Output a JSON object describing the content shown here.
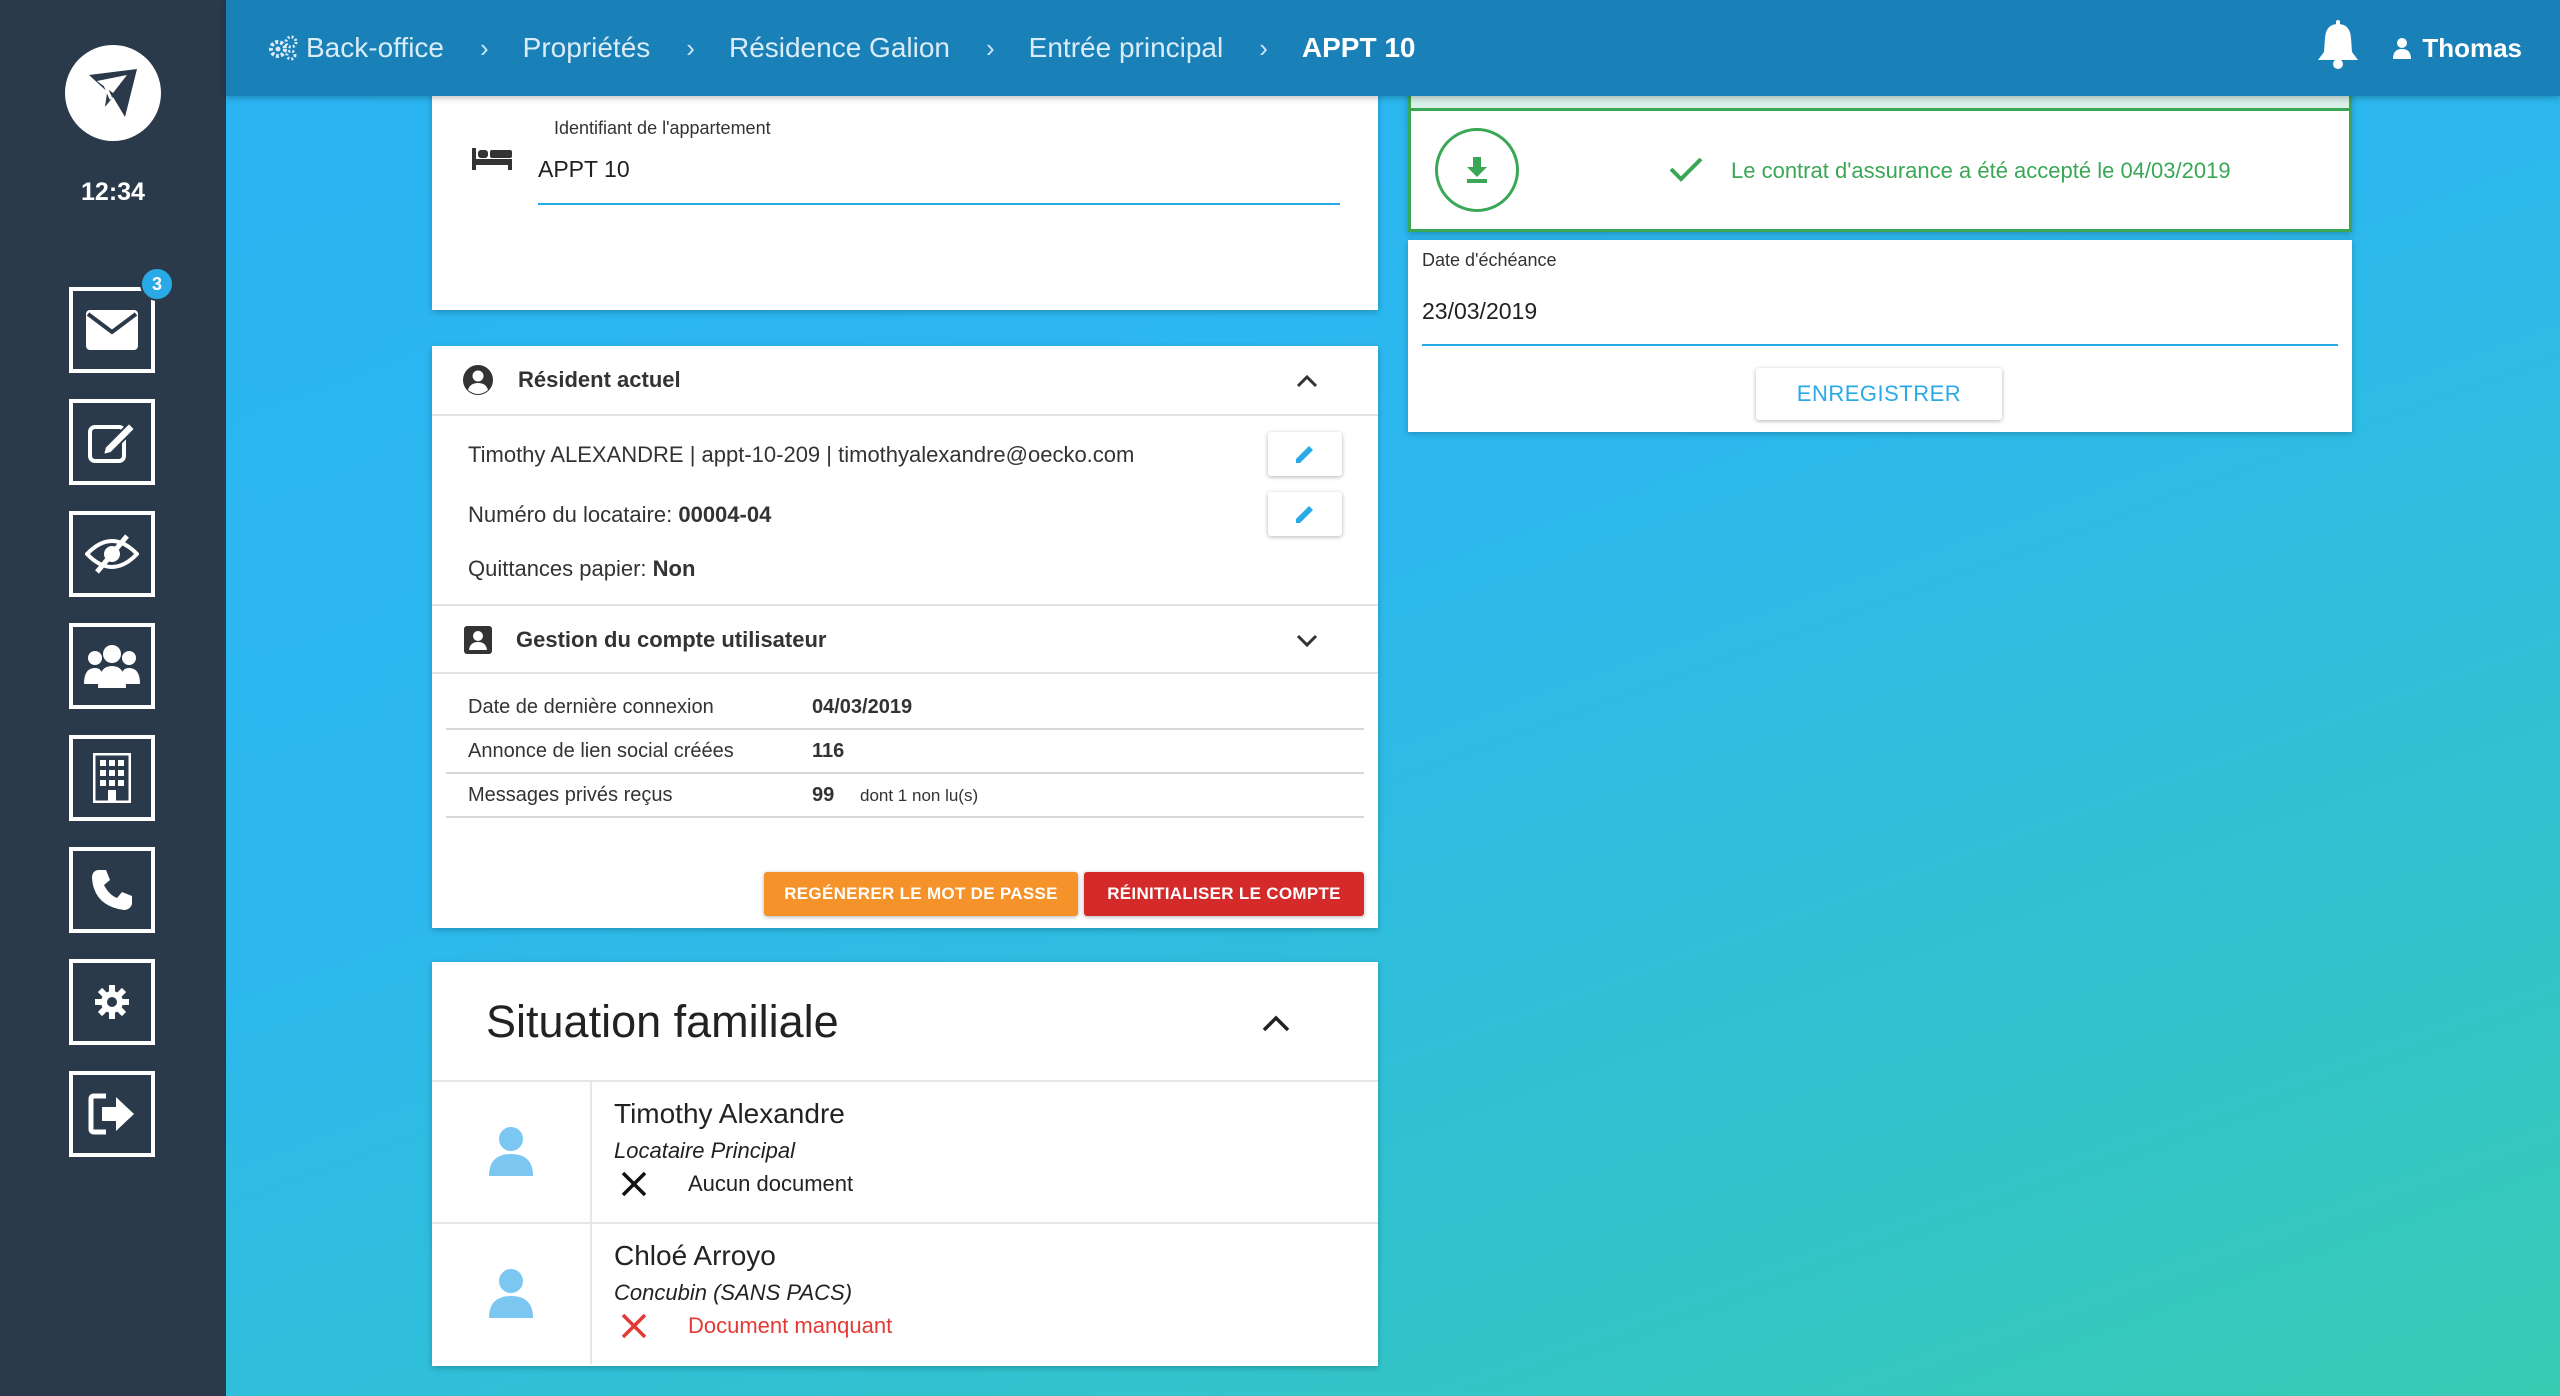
{
  "sidebar": {
    "time": "12:34",
    "mail_badge": "3",
    "items": [
      {
        "name": "mail"
      },
      {
        "name": "edit"
      },
      {
        "name": "visibility"
      },
      {
        "name": "users"
      },
      {
        "name": "building"
      },
      {
        "name": "phone"
      },
      {
        "name": "settings"
      },
      {
        "name": "logout"
      }
    ]
  },
  "header": {
    "breadcrumb": [
      "Back-office",
      "Propriétés",
      "Résidence Galion",
      "Entrée principal",
      "APPT 10"
    ],
    "user": "Thomas"
  },
  "apartment": {
    "id_label": "Identifiant de l'appartement",
    "id_value": "APPT 10"
  },
  "resident": {
    "title": "Résident actuel",
    "line1": "Timothy ALEXANDRE | appt-10-209 | timothyalexandre@oecko.com",
    "tenant_number_label": "Numéro du locataire:",
    "tenant_number": "00004-04",
    "paper_receipts_label": "Quittances papier:",
    "paper_receipts": "Non"
  },
  "account": {
    "title": "Gestion du compte utilisateur",
    "rows": [
      {
        "label": "Date de dernière connexion",
        "value": "04/03/2019",
        "note": ""
      },
      {
        "label": "Annonce de lien social créées",
        "value": "116",
        "note": ""
      },
      {
        "label": "Messages privés reçus",
        "value": "99",
        "note": "dont 1 non lu(s)"
      }
    ],
    "regen_button": "REGÉNERER LE MOT DE PASSE",
    "reset_button": "RÉINITIALISER LE COMPTE"
  },
  "family": {
    "title": "Situation familiale",
    "members": [
      {
        "name": "Timothy Alexandre",
        "role": "Locataire Principal",
        "doc_status": "Aucun document"
      },
      {
        "name": "Chloé Arroyo",
        "role": "Concubin (SANS PACS)",
        "doc_status": "Document manquant"
      }
    ]
  },
  "insurance": {
    "message": "Le contrat d'assurance a été accepté le 04/03/2019",
    "due_label": "Date d'échéance",
    "due_value": "23/03/2019",
    "save_button": "ENREGISTRER"
  },
  "colors": {
    "accent": "#29a9e6",
    "success": "#3aa756",
    "warning": "#f5922a",
    "danger": "#d42a2a",
    "sidebar": "#2b3a4b",
    "topbar": "#1a80b8"
  }
}
